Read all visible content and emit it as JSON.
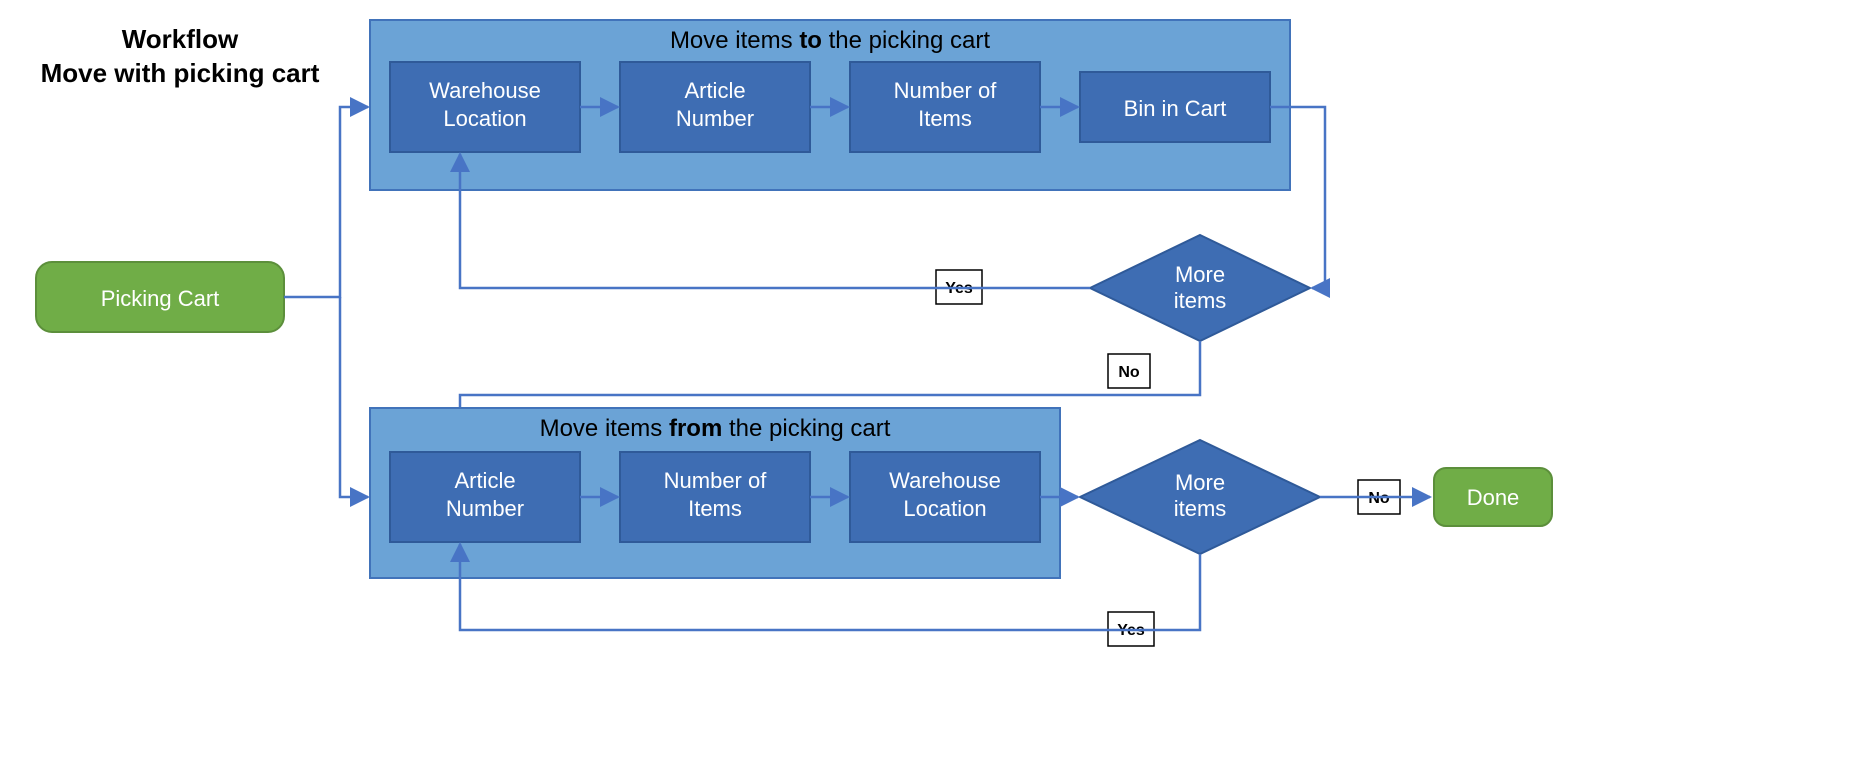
{
  "title_line1": "Workflow",
  "title_line2": "Move with picking cart",
  "start": "Picking Cart",
  "group_to": {
    "pre": "Move items ",
    "bold": "to",
    "post": " the picking cart"
  },
  "group_from": {
    "pre": "Move items ",
    "bold": "from",
    "post": " the picking cart"
  },
  "to_steps": [
    "Warehouse Location",
    "Article Number",
    "Number of Items",
    "Bin in Cart"
  ],
  "from_steps": [
    "Article Number",
    "Number of Items",
    "Warehouse Location"
  ],
  "decision": "More items",
  "yes": "Yes",
  "no": "No",
  "done": "Done",
  "colors": {
    "groupFill": "#6ba3d6",
    "groupStroke": "#4173ba",
    "boxFill": "#3e6db3",
    "boxStroke": "#2f5a99",
    "green": "#70ad47",
    "greenStroke": "#5c8f3b",
    "arrow": "#4874c5",
    "diamond": "#3e6db3"
  }
}
